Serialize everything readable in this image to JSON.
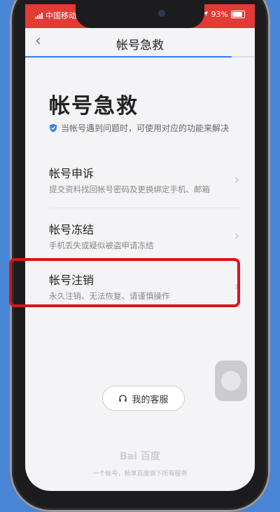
{
  "status": {
    "carrier": "中国移动",
    "wifi_icon": "wifi-icon",
    "battery": "93%",
    "location_icon": "location-arrow-icon"
  },
  "nav": {
    "back_icon": "chevron-left-icon",
    "title": "帐号急救",
    "progress": 0.9
  },
  "header": {
    "title": "帐号急救",
    "subtitle": "当帐号遇到问题时，可使用对应的功能来解决"
  },
  "items": [
    {
      "title": "帐号申诉",
      "desc": "提交资料找回帐号密码及更换绑定手机、邮箱"
    },
    {
      "title": "帐号冻结",
      "desc": "手机丢失或疑似被盗申请冻结"
    },
    {
      "title": "帐号注销",
      "desc": "永久注销、无法恢复、请谨慎操作"
    }
  ],
  "service": {
    "label": "我的客服"
  },
  "footer": {
    "logo": "Bai 百度",
    "note": "一个帐号，畅享百度旗下所有服务"
  },
  "colors": {
    "status_bar": "#e23a35",
    "highlight": "#e0101a",
    "progress": "#2f7df6"
  }
}
